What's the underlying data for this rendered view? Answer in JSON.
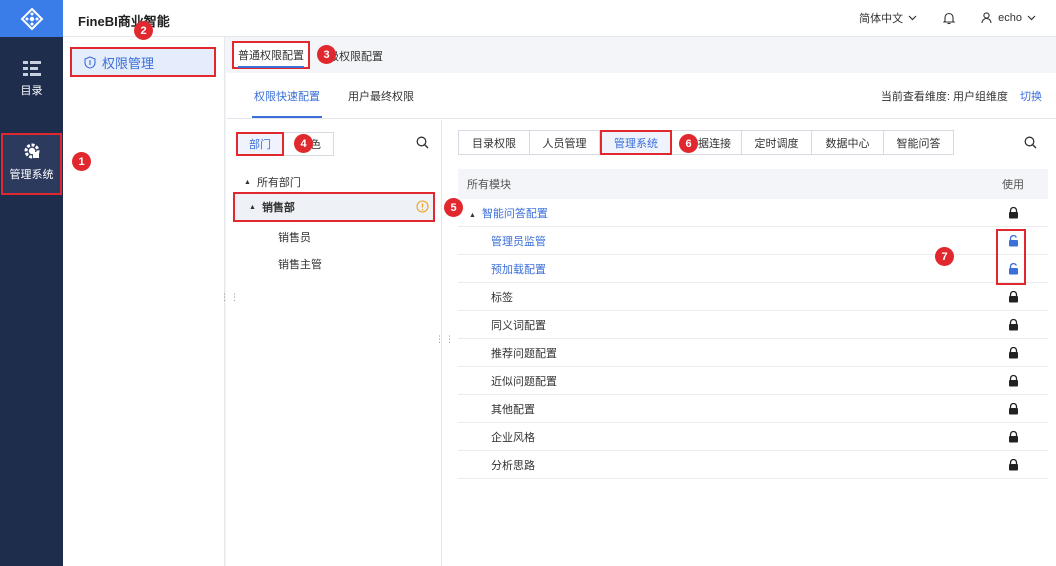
{
  "app": {
    "title": "FineBI商业智能"
  },
  "header": {
    "language": "简体中文",
    "user": "echo"
  },
  "nav": {
    "items": [
      {
        "label": "目录"
      },
      {
        "label": "管理系统"
      }
    ]
  },
  "panel": {
    "permission_item": "权限管理"
  },
  "tabs": {
    "main": "普通权限配置",
    "second": "级权限配置"
  },
  "subtabs": {
    "quick": "权限快速配置",
    "final": "用户最终权限"
  },
  "dimension": {
    "label": "当前查看维度: 用户组维度",
    "switch": "切换"
  },
  "tree": {
    "seg_dept": "部门",
    "seg_role": "色",
    "root": "所有部门",
    "selected": "销售部",
    "children": [
      "销售员",
      "销售主管"
    ]
  },
  "module_tabs": [
    "目录权限",
    "人员管理",
    "管理系统",
    "据连接",
    "定时调度",
    "数据中心",
    "智能问答"
  ],
  "table": {
    "header_module": "所有模块",
    "header_use": "使用",
    "rows": [
      {
        "label": "智能问答配置",
        "lock": "locked"
      },
      {
        "label": "管理员监管",
        "lock": "unlocked"
      },
      {
        "label": "预加载配置",
        "lock": "unlocked"
      },
      {
        "label": "标签",
        "lock": "locked"
      },
      {
        "label": "同义词配置",
        "lock": "locked"
      },
      {
        "label": "推荐问题配置",
        "lock": "locked"
      },
      {
        "label": "近似问题配置",
        "lock": "locked"
      },
      {
        "label": "其他配置",
        "lock": "locked"
      },
      {
        "label": "企业风格",
        "lock": "locked"
      },
      {
        "label": "分析思路",
        "lock": "locked"
      }
    ]
  },
  "markers": [
    "1",
    "2",
    "3",
    "4",
    "5",
    "6",
    "7"
  ],
  "colors": {
    "accent": "#3b6fd9",
    "nav": "#1f2d4d",
    "highlight": "#e0282e"
  }
}
